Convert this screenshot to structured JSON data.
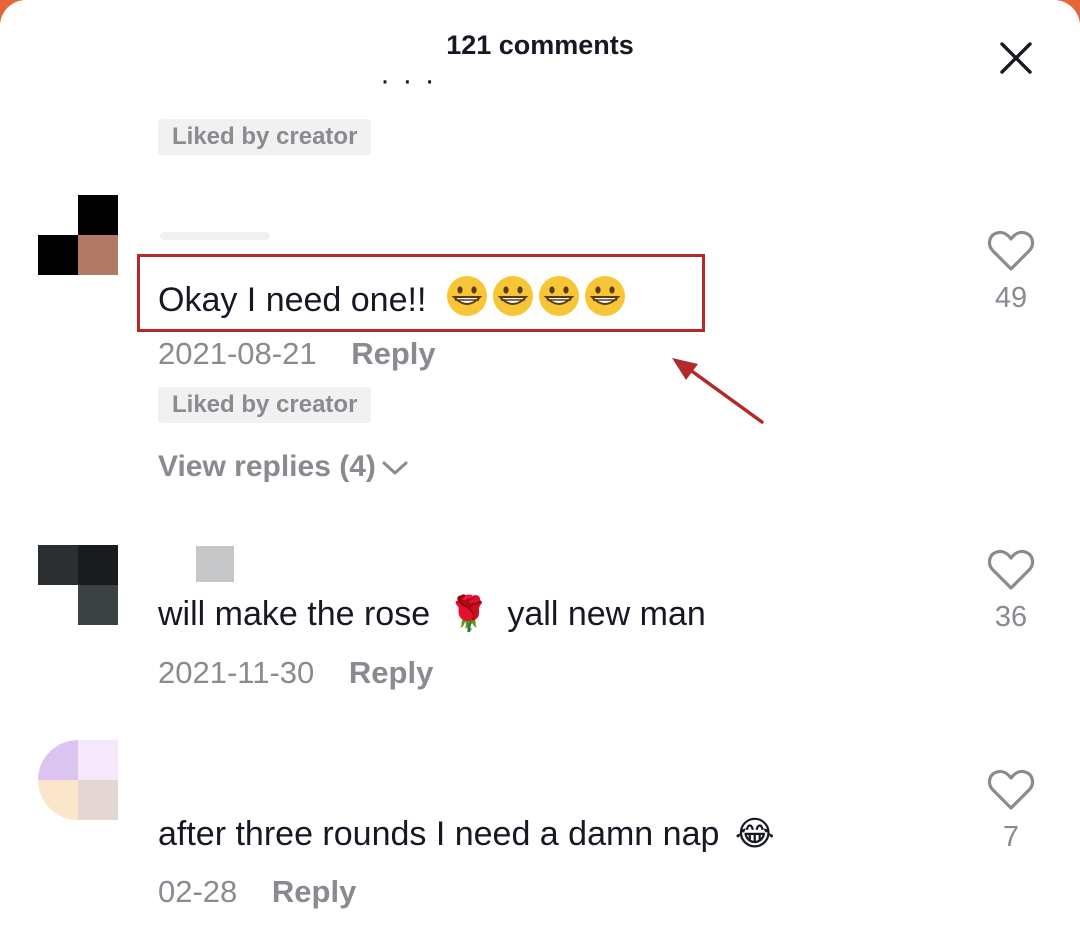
{
  "header": {
    "title": "121 comments"
  },
  "top_fragment": {
    "cut_text": "· · ·",
    "badge": "Liked by creator"
  },
  "comments": [
    {
      "text": "Okay I need one!!",
      "emoji": "grinning-face",
      "emoji_count": 4,
      "date": "2021-08-21",
      "reply_label": "Reply",
      "badge": "Liked by creator",
      "view_replies": "View replies (4)",
      "likes": "49"
    },
    {
      "text_before": "will make the rose",
      "emoji": "🌹",
      "text_after": "yall new man",
      "date": "2021-11-30",
      "reply_label": "Reply",
      "likes": "36"
    },
    {
      "text": "after three rounds I need a damn nap",
      "emoji": "😂",
      "date": "02-28",
      "reply_label": "Reply",
      "likes": "7"
    }
  ],
  "colors": {
    "background_accent": "#e8643a",
    "text_primary": "#161823",
    "text_secondary": "#8a8b91",
    "badge_bg": "#f1f1f2",
    "annotation_red": "#b32a2a"
  },
  "icons": {
    "close": "close-icon",
    "like": "heart-outline-icon",
    "expand": "chevron-down-icon"
  }
}
